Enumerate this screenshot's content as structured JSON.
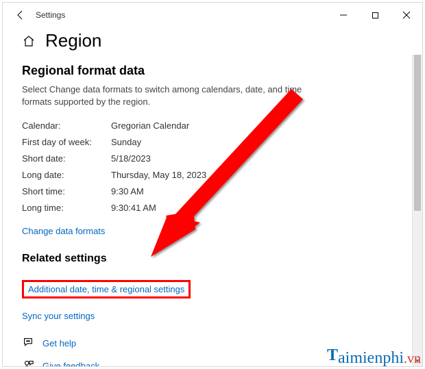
{
  "titlebar": {
    "title": "Settings"
  },
  "page": {
    "title": "Region"
  },
  "section": {
    "heading": "Regional format data",
    "desc": "Select Change data formats to switch among calendars, date, and time formats supported by the region."
  },
  "formats": {
    "rows": [
      {
        "k": "Calendar:",
        "v": "Gregorian Calendar"
      },
      {
        "k": "First day of week:",
        "v": "Sunday"
      },
      {
        "k": "Short date:",
        "v": "5/18/2023"
      },
      {
        "k": "Long date:",
        "v": "Thursday, May 18, 2023"
      },
      {
        "k": "Short time:",
        "v": "9:30 AM"
      },
      {
        "k": "Long time:",
        "v": "9:30:41 AM"
      }
    ]
  },
  "links": {
    "change_formats": "Change data formats",
    "related_heading": "Related settings",
    "additional": "Additional date, time & regional settings",
    "sync": "Sync your settings",
    "get_help": "Get help",
    "feedback": "Give feedback"
  },
  "watermark": {
    "text": "Taimienphi",
    "suffix": ".vn"
  }
}
